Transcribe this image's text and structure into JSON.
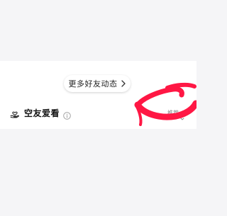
{
  "friends_feed": {
    "more_updates_label": "更多好友动态"
  },
  "recommend_section": {
    "title": "空友爱看",
    "sort_label": "推荐"
  },
  "icons": {
    "more_chevron": "chevron-right-icon",
    "section_icon": "hand-heart-icon",
    "info": "info-icon",
    "sort_chevron": "chevron-down-icon"
  },
  "colors": {
    "page_background": "#f5f5f7",
    "card_background": "#ffffff",
    "annotation_red": "#ff1744"
  }
}
